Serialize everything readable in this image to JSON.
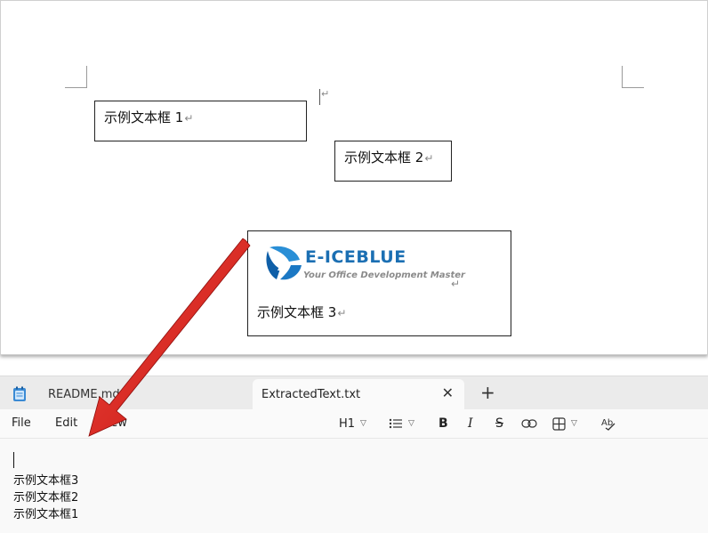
{
  "document": {
    "textboxes": [
      {
        "text": "示例文本框 1"
      },
      {
        "text": "示例文本框 2"
      },
      {
        "text": "示例文本框 3"
      }
    ],
    "paragraph_mark": "↵",
    "logo": {
      "name": "E-ICEBLUE",
      "tagline": "Your Office Development Master"
    }
  },
  "notepad": {
    "tabs": [
      {
        "label": "README.md",
        "icon": "notepad-icon"
      },
      {
        "label": "ExtractedText.txt",
        "close": "✕"
      }
    ],
    "add_tab": "+",
    "menu": {
      "file": "File",
      "edit": "Edit",
      "view": "View"
    },
    "toolbar": {
      "heading": "H1",
      "bold": "B",
      "italic": "I",
      "strikethrough": "S"
    },
    "lines": [
      "示例文本框3",
      "示例文本框2",
      "示例文本框1"
    ]
  },
  "colors": {
    "arrow": "#e8211d",
    "brand": "#1b6fb3"
  }
}
